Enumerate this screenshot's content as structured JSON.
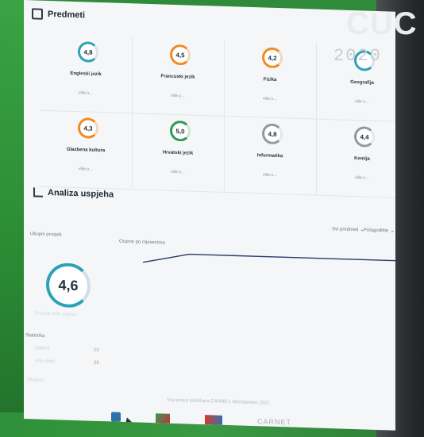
{
  "header": {
    "title": "Predmeti"
  },
  "overlay": {
    "brand": "CUC",
    "digits": "2020"
  },
  "cards": [
    {
      "name": "Engleski jezik",
      "grade": "4,8",
      "more": "više o…",
      "color": "#2aa3b5"
    },
    {
      "name": "Francuski jezik",
      "grade": "4,5",
      "more": "više o…",
      "color": "#f08a24"
    },
    {
      "name": "Fizika",
      "grade": "4,2",
      "more": "više o…",
      "color": "#f08a24"
    },
    {
      "name": "Geografija",
      "grade": "",
      "more": "više o…",
      "color": "#2aa3b5"
    },
    {
      "name": "Glazbena kultura",
      "grade": "4,3",
      "more": "više o…",
      "color": "#f08a24"
    },
    {
      "name": "Hrvatski jezik",
      "grade": "5,0",
      "more": "više o…",
      "color": "#2b9b56"
    },
    {
      "name": "Informatika",
      "grade": "4,8",
      "more": "više o…",
      "color": "#8e9aa2"
    },
    {
      "name": "Kemija",
      "grade": "4,4",
      "more": "više o…",
      "color": "#8e9aa2"
    }
  ],
  "analysis": {
    "title": "Analiza uspjeha",
    "help": "? ⊙",
    "filter1": "Svi predmeti",
    "filter2": "Polugodište",
    "label_avg": "Ukupni prosjek",
    "label_chart": "Ocjene po mjesecima",
    "avg": "4,6",
    "avg_caption": "Prosjek svih ocjena",
    "side_title": "Statistika",
    "side_items": [
      "Odlični",
      "Vrlo dobri"
    ],
    "side_values": [
      "68",
      "25"
    ],
    "side_extra": "Ukupno"
  },
  "footer": {
    "copyright": "Sva prava pridržana CARNET, Ministarstvo 2021",
    "carnet": "CARNET"
  },
  "chart_data": {
    "type": "line",
    "x": [
      1,
      2,
      3,
      4,
      5,
      6,
      7,
      8,
      9,
      10,
      11,
      12
    ],
    "values": [
      4.4,
      4.5,
      4.6,
      4.6,
      4.6,
      4.6,
      4.6,
      4.6,
      4.6,
      4.6,
      4.6,
      4.6
    ]
  }
}
